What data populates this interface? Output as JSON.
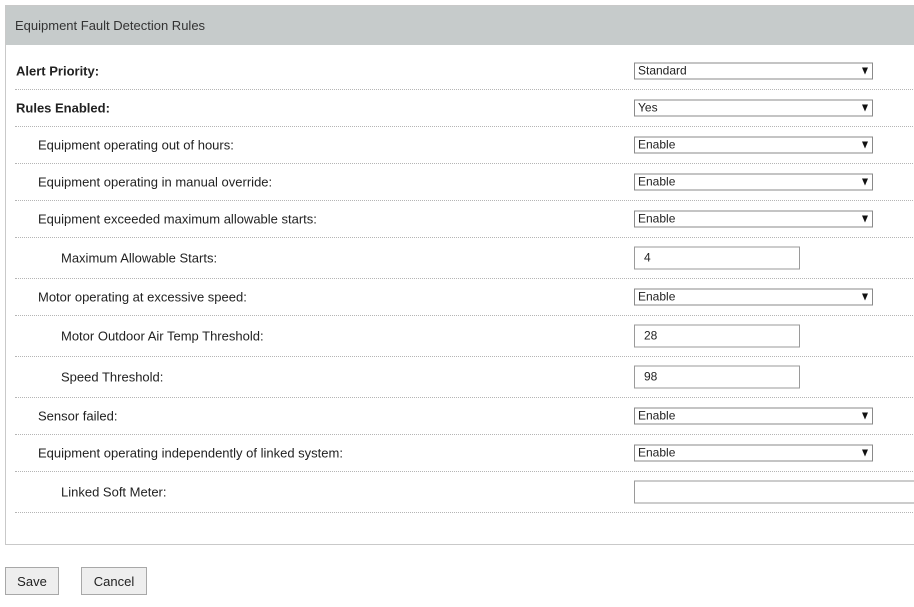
{
  "panel": {
    "title": "Equipment Fault Detection Rules"
  },
  "rules": [
    {
      "label": "Alert Priority:",
      "type": "select",
      "value": "Standard"
    },
    {
      "label": "Rules Enabled:",
      "type": "select",
      "value": "Yes"
    },
    {
      "label": "Equipment operating out of hours:",
      "type": "select",
      "value": "Enable"
    },
    {
      "label": "Equipment operating in manual override:",
      "type": "select",
      "value": "Enable"
    },
    {
      "label": "Equipment exceeded maximum allowable starts:",
      "type": "select",
      "value": "Enable"
    },
    {
      "label": "Maximum Allowable Starts:",
      "type": "text",
      "value": "4"
    },
    {
      "label": "Motor operating at excessive speed:",
      "type": "select",
      "value": "Enable"
    },
    {
      "label": "Motor Outdoor Air Temp Threshold:",
      "type": "text",
      "value": "28"
    },
    {
      "label": "Speed Threshold:",
      "type": "text",
      "value": "98"
    },
    {
      "label": "Sensor failed:",
      "type": "select",
      "value": "Enable"
    },
    {
      "label": "Equipment operating independently of linked system:",
      "type": "select",
      "value": "Enable"
    },
    {
      "label": "Linked Soft Meter:",
      "type": "text",
      "value": ""
    }
  ],
  "actions": {
    "save_label": "Save",
    "cancel_label": "Cancel"
  },
  "icons": {
    "dropdown": "chevron-down-icon"
  }
}
